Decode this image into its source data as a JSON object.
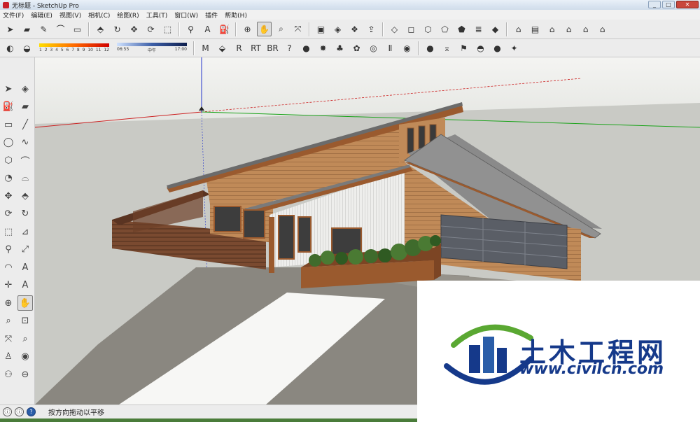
{
  "window": {
    "title": "无标题 - SketchUp Pro",
    "controls": [
      "_",
      "□",
      "✕"
    ]
  },
  "menu": [
    "文件(F)",
    "编辑(E)",
    "视图(V)",
    "相机(C)",
    "绘图(R)",
    "工具(T)",
    "窗口(W)",
    "插件",
    "帮助(H)"
  ],
  "toolbar_row1": [
    {
      "name": "select-icon",
      "glyph": "➤"
    },
    {
      "name": "eraser-icon",
      "glyph": "▰"
    },
    {
      "name": "pencil-icon",
      "glyph": "✎"
    },
    {
      "name": "arc-icon",
      "glyph": "⌒"
    },
    {
      "name": "rectangle-icon",
      "glyph": "▭"
    },
    {
      "name": "push-pull-icon",
      "glyph": "⬘"
    },
    {
      "name": "follow-me-icon",
      "glyph": "↻"
    },
    {
      "name": "move-icon",
      "glyph": "✥"
    },
    {
      "name": "rotate-icon",
      "glyph": "⟳"
    },
    {
      "name": "scale-icon",
      "glyph": "⬚"
    },
    {
      "name": "tape-measure-icon",
      "glyph": "⚲"
    },
    {
      "name": "text-icon",
      "glyph": "A"
    },
    {
      "name": "paint-bucket-icon",
      "glyph": "⛽"
    },
    {
      "name": "orbit-icon",
      "glyph": "⊕"
    },
    {
      "name": "pan-icon",
      "glyph": "✋"
    },
    {
      "name": "zoom-icon",
      "glyph": "⌕"
    },
    {
      "name": "zoom-extents-icon",
      "glyph": "⤧"
    },
    {
      "name": "warehouse-icon",
      "glyph": "▣"
    },
    {
      "name": "share-model-icon",
      "glyph": "◈"
    },
    {
      "name": "components-icon",
      "glyph": "❖"
    },
    {
      "name": "send-to-layout-icon",
      "glyph": "⇪"
    },
    {
      "name": "xray-icon",
      "glyph": "◇"
    },
    {
      "name": "back-edges-icon",
      "glyph": "◻"
    },
    {
      "name": "wireframe-icon",
      "glyph": "⬡"
    },
    {
      "name": "hidden-line-icon",
      "glyph": "⬠"
    },
    {
      "name": "shaded-icon",
      "glyph": "⬟"
    },
    {
      "name": "monochrome-icon",
      "glyph": "≣"
    },
    {
      "name": "textured-icon",
      "glyph": "◆"
    },
    {
      "name": "iso-view-icon",
      "glyph": "⌂"
    },
    {
      "name": "top-view-icon",
      "glyph": "▤"
    },
    {
      "name": "front-view-icon",
      "glyph": "⌂"
    },
    {
      "name": "right-view-icon",
      "glyph": "⌂"
    },
    {
      "name": "back-view-icon",
      "glyph": "⌂"
    },
    {
      "name": "left-view-icon",
      "glyph": "⌂"
    }
  ],
  "toolbar_row2": [
    {
      "name": "shadow-toggle-icon",
      "glyph": "◐"
    },
    {
      "name": "fog-icon",
      "glyph": "◒"
    }
  ],
  "shadow_months": {
    "labels": [
      "1",
      "2",
      "3",
      "4",
      "5",
      "6",
      "7",
      "8",
      "9",
      "10",
      "11",
      "12"
    ]
  },
  "shadow_time": {
    "start": "06:55",
    "mid": "中午",
    "end": "17:00"
  },
  "toolbar_row2_plugins": [
    {
      "name": "plugin-m-icon",
      "glyph": "M"
    },
    {
      "name": "plugin-tag-icon",
      "glyph": "⬙"
    },
    {
      "name": "plugin-r-icon",
      "glyph": "R"
    },
    {
      "name": "plugin-rt-icon",
      "glyph": "RT"
    },
    {
      "name": "plugin-br-icon",
      "glyph": "BR"
    },
    {
      "name": "plugin-help-icon",
      "glyph": "?"
    },
    {
      "name": "plugin-sphere-icon",
      "glyph": "●"
    },
    {
      "name": "plugin-sun-icon",
      "glyph": "✸"
    },
    {
      "name": "plugin-tree-icon",
      "glyph": "♣"
    },
    {
      "name": "plugin-flower-icon",
      "glyph": "✿"
    },
    {
      "name": "plugin-target-icon",
      "glyph": "◎"
    },
    {
      "name": "plugin-pause-icon",
      "glyph": "Ⅱ"
    },
    {
      "name": "plugin-spiral-icon",
      "glyph": "◉"
    },
    {
      "name": "light-omni-icon",
      "glyph": "●"
    },
    {
      "name": "light-spot-icon",
      "glyph": "⌅"
    },
    {
      "name": "light-flag-icon",
      "glyph": "⚑"
    },
    {
      "name": "light-dome-icon",
      "glyph": "◓"
    },
    {
      "name": "light-sphere-icon",
      "glyph": "●"
    },
    {
      "name": "light-ies-icon",
      "glyph": "✦"
    }
  ],
  "sidebar": [
    {
      "name": "select-icon",
      "glyph": "➤"
    },
    {
      "name": "component-icon",
      "glyph": "◈"
    },
    {
      "name": "paint-bucket-icon",
      "glyph": "⛽"
    },
    {
      "name": "eraser-icon",
      "glyph": "▰"
    },
    {
      "name": "rectangle-icon",
      "glyph": "▭"
    },
    {
      "name": "line-icon",
      "glyph": "╱"
    },
    {
      "name": "circle-icon",
      "glyph": "◯"
    },
    {
      "name": "freehand-icon",
      "glyph": "∿"
    },
    {
      "name": "polygon-icon",
      "glyph": "⬡"
    },
    {
      "name": "arc-icon",
      "glyph": "⌒"
    },
    {
      "name": "pie-icon",
      "glyph": "◔"
    },
    {
      "name": "arc3-icon",
      "glyph": "⌓"
    },
    {
      "name": "move-icon",
      "glyph": "✥"
    },
    {
      "name": "push-pull-icon",
      "glyph": "⬘"
    },
    {
      "name": "rotate-icon",
      "glyph": "⟳"
    },
    {
      "name": "follow-me-icon",
      "glyph": "↻"
    },
    {
      "name": "scale-icon",
      "glyph": "⬚"
    },
    {
      "name": "offset-icon",
      "glyph": "⊿"
    },
    {
      "name": "tape-measure-icon",
      "glyph": "⚲"
    },
    {
      "name": "dimension-icon",
      "glyph": "⤢"
    },
    {
      "name": "protractor-icon",
      "glyph": "◠"
    },
    {
      "name": "text-icon",
      "glyph": "A"
    },
    {
      "name": "axes-icon",
      "glyph": "✛"
    },
    {
      "name": "3d-text-icon",
      "glyph": "A"
    },
    {
      "name": "orbit-icon",
      "glyph": "⊕"
    },
    {
      "name": "pan-icon",
      "glyph": "✋"
    },
    {
      "name": "zoom-icon",
      "glyph": "⌕"
    },
    {
      "name": "zoom-window-icon",
      "glyph": "⊡"
    },
    {
      "name": "zoom-extents-icon",
      "glyph": "⤧"
    },
    {
      "name": "previous-view-icon",
      "glyph": "⌕"
    },
    {
      "name": "position-camera-icon",
      "glyph": "♙"
    },
    {
      "name": "look-around-icon",
      "glyph": "◉"
    },
    {
      "name": "walk-icon",
      "glyph": "⚇"
    },
    {
      "name": "section-plane-icon",
      "glyph": "⊖"
    }
  ],
  "status": {
    "message": "按方向拖动以平移",
    "icons": [
      "ⓘ",
      "ⓘ",
      "?"
    ]
  },
  "watermark": {
    "name_cn": "土木工程网",
    "url": "www.civilcn.com"
  },
  "colors": {
    "axis_red": "#cc2222",
    "axis_green": "#1aa31a",
    "axis_blue": "#2233cc",
    "wood": "#b87a4a",
    "roof": "#8c8c8c",
    "logo_blue": "#15398a",
    "logo_green": "#5aa832"
  }
}
